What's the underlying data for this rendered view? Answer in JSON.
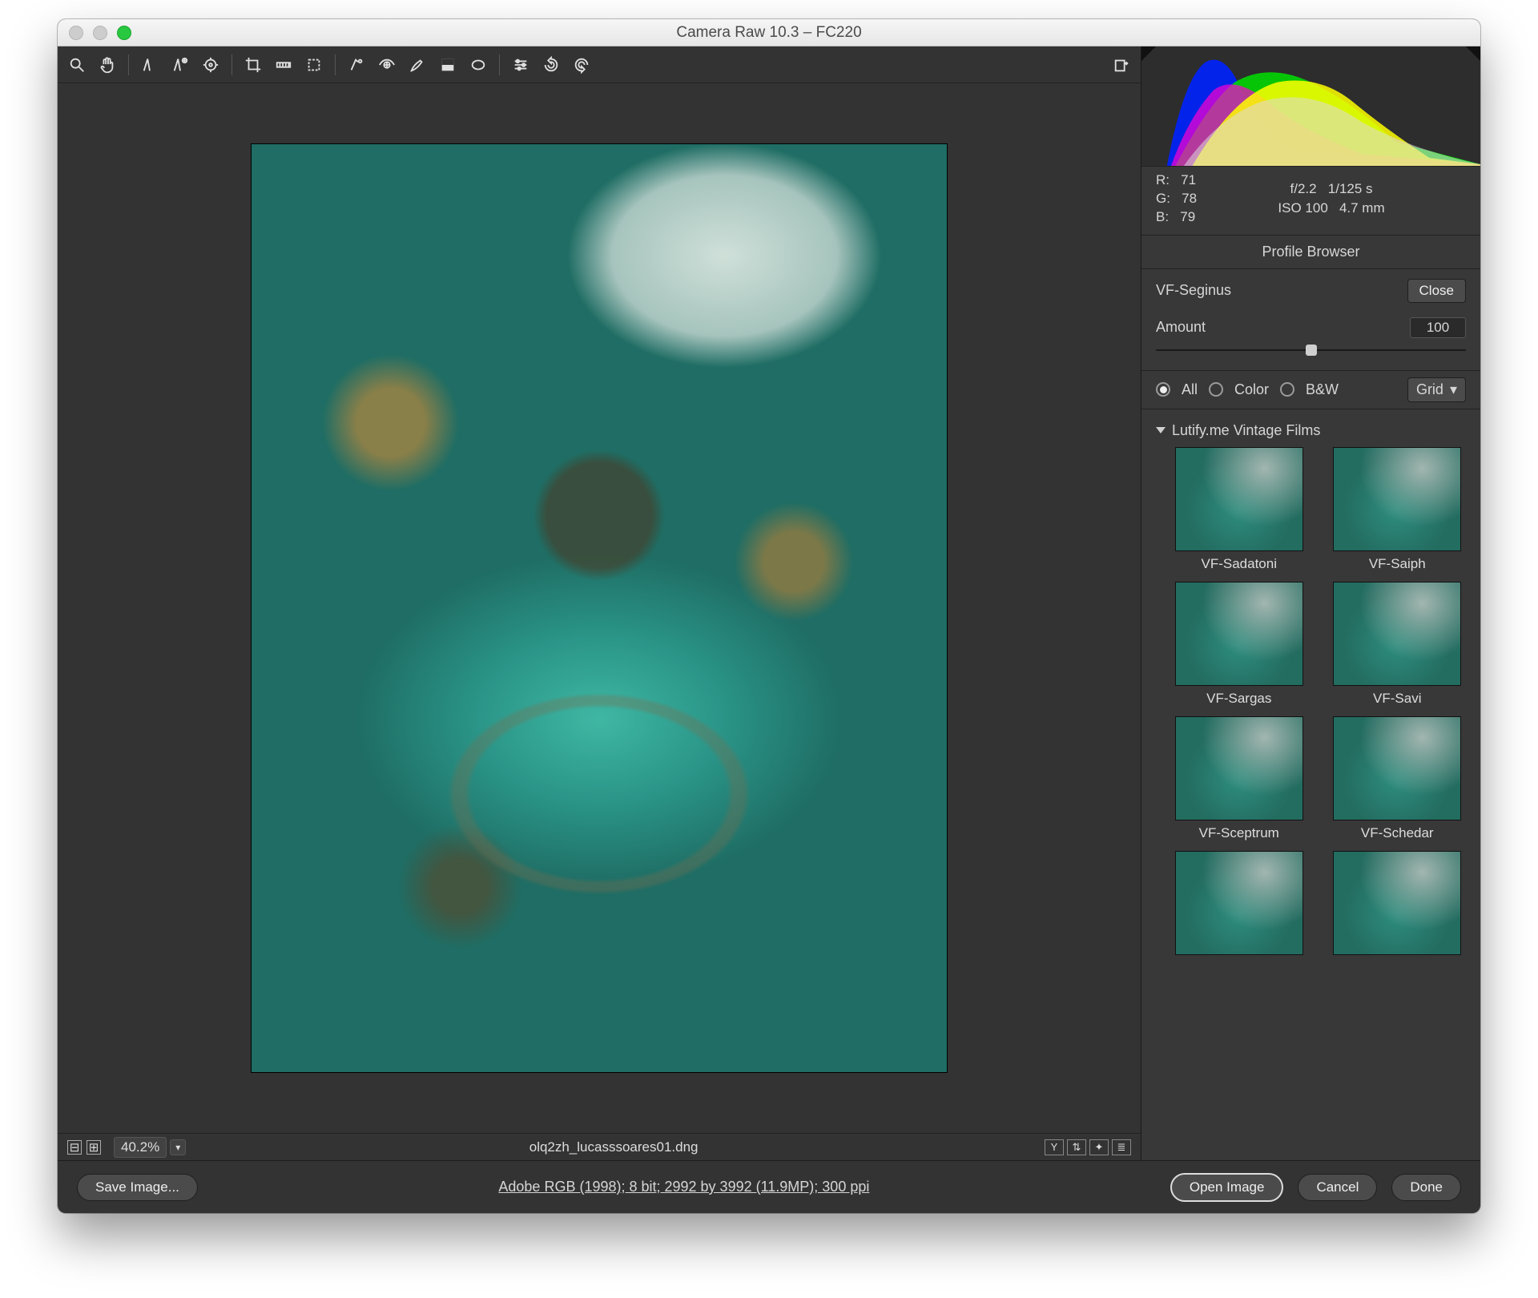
{
  "title": "Camera Raw 10.3  –  FC220",
  "toolbar": {
    "tools": [
      "zoom",
      "hand",
      "white-balance",
      "color-sampler",
      "target-adjust",
      "crop",
      "straighten",
      "transform",
      "spot-removal",
      "red-eye",
      "adjustment-brush",
      "graduated-filter",
      "radial-filter",
      "preferences",
      "rotate-ccw",
      "rotate-cw"
    ],
    "export_icon": "open-copy"
  },
  "zoombar": {
    "fit_minus": "⊟",
    "fit_plus": "⊞",
    "zoom": "40.2%",
    "filename": "olq2zh_lucasssoares01.dng",
    "right_buttons": [
      "Y",
      "⇅",
      "✦",
      "≣"
    ]
  },
  "meta": {
    "r_label": "R:",
    "r": "71",
    "g_label": "G:",
    "g": "78",
    "b_label": "B:",
    "b": "79",
    "aperture": "f/2.2",
    "shutter": "1/125 s",
    "iso": "ISO 100",
    "focal": "4.7 mm"
  },
  "profile_browser": {
    "header": "Profile Browser",
    "name": "VF-Seginus",
    "close": "Close",
    "amount_label": "Amount",
    "amount_value": "100",
    "filter_all": "All",
    "filter_color": "Color",
    "filter_bw": "B&W",
    "view_label": "Grid",
    "group": "Lutify.me Vintage Films",
    "thumbs": [
      "VF-Sadatoni",
      "VF-Saiph",
      "VF-Sargas",
      "VF-Savi",
      "VF-Sceptrum",
      "VF-Schedar",
      "",
      ""
    ]
  },
  "footer": {
    "save": "Save Image...",
    "workflow": "Adobe RGB (1998); 8 bit; 2992 by 3992 (11.9MP); 300 ppi",
    "open": "Open Image",
    "cancel": "Cancel",
    "done": "Done"
  }
}
